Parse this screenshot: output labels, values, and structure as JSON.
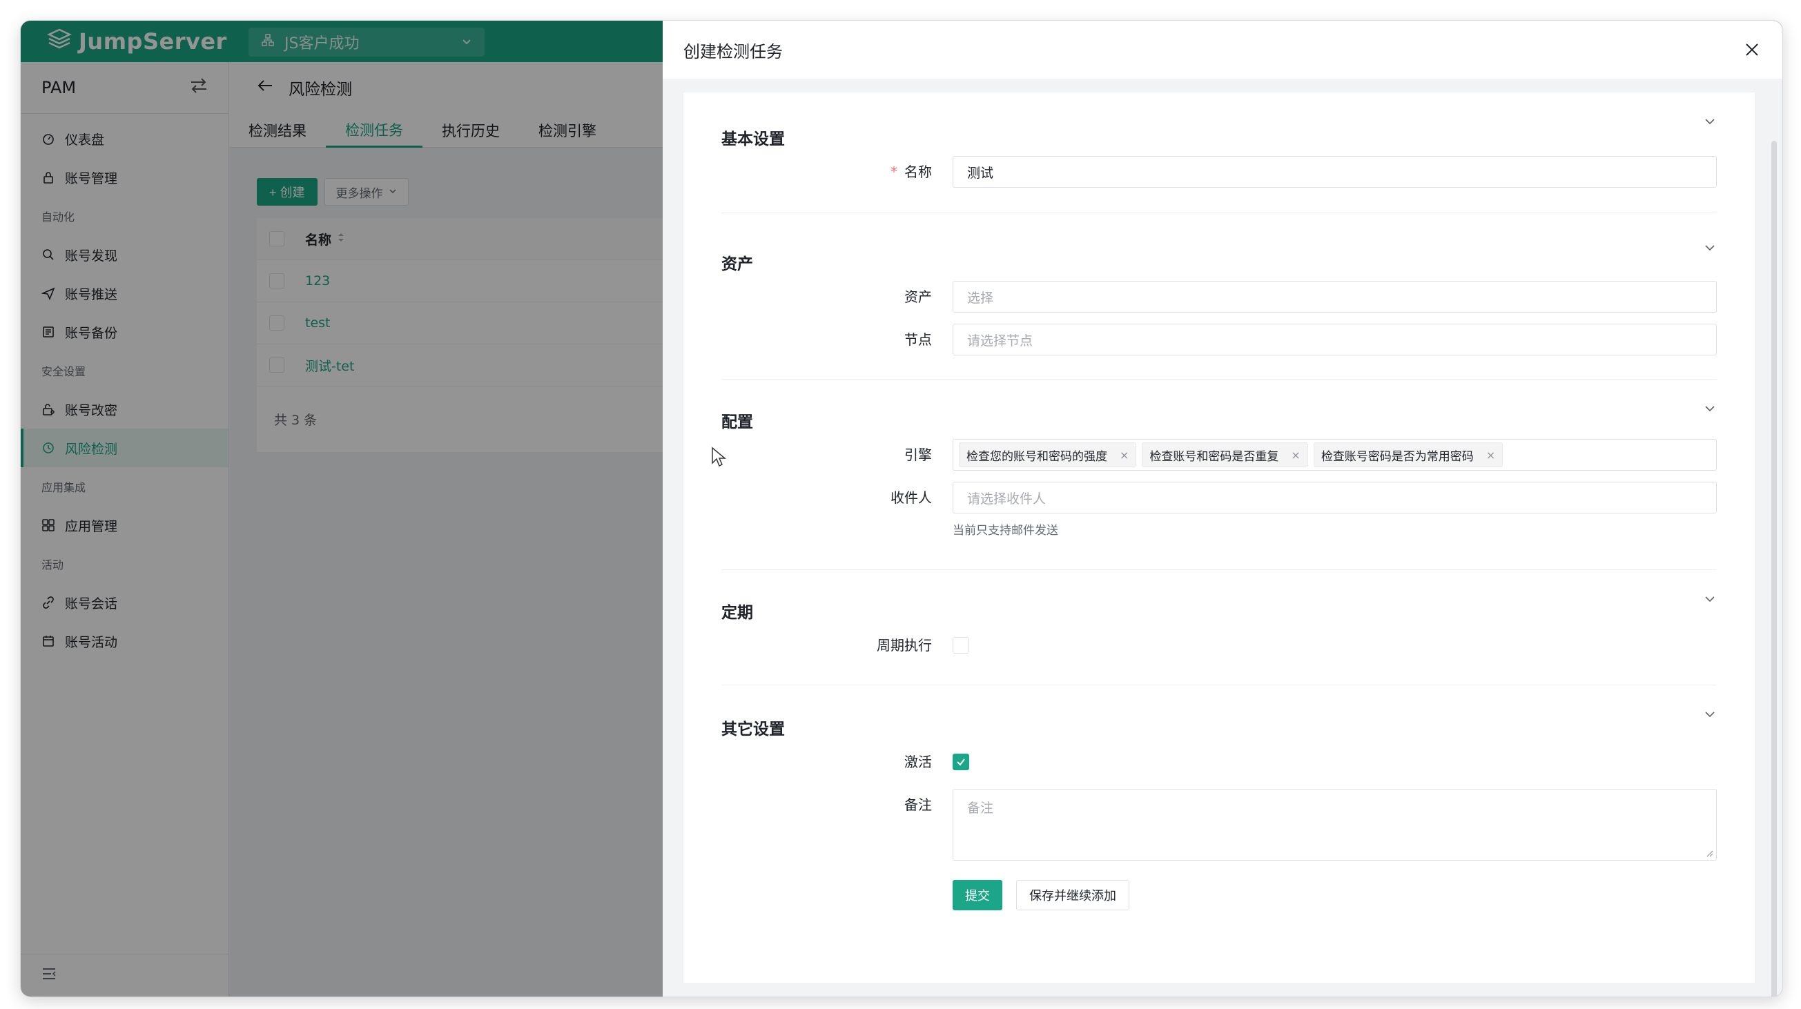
{
  "app": {
    "logo_text": "JumpServer",
    "org_name": "JS客户成功"
  },
  "sidebar": {
    "title": "PAM",
    "items": [
      {
        "label": "仪表盘",
        "icon": "dashboard-icon"
      },
      {
        "label": "账号管理",
        "icon": "lock-icon"
      }
    ],
    "group_automation": "自动化",
    "automation_items": [
      {
        "label": "账号发现",
        "icon": "search-icon"
      },
      {
        "label": "账号推送",
        "icon": "send-icon"
      },
      {
        "label": "账号备份",
        "icon": "backup-icon"
      }
    ],
    "group_security": "安全设置",
    "security_items": [
      {
        "label": "账号改密",
        "icon": "key-lock-icon"
      },
      {
        "label": "风险检测",
        "icon": "risk-icon",
        "active": true
      }
    ],
    "group_integration": "应用集成",
    "integration_items": [
      {
        "label": "应用管理",
        "icon": "apps-icon"
      }
    ],
    "group_activity": "活动",
    "activity_items": [
      {
        "label": "账号会话",
        "icon": "link-icon"
      },
      {
        "label": "账号活动",
        "icon": "calendar-icon"
      }
    ]
  },
  "page": {
    "title": "风险检测",
    "tabs": [
      "检测结果",
      "检测任务",
      "执行历史",
      "检测引擎"
    ],
    "active_tab": 1,
    "create_label": "+ 创建",
    "more_label": "更多操作",
    "table": {
      "header_name": "名称",
      "rows": [
        "123",
        "test",
        "测试-tet"
      ]
    },
    "total_text": "共 3 条"
  },
  "drawer": {
    "title": "创建检测任务",
    "sections": {
      "basic": "基本设置",
      "assets": "资产",
      "config": "配置",
      "periodic": "定期",
      "other": "其它设置"
    },
    "fields": {
      "name_label": "名称",
      "name_value": "测试",
      "asset_label": "资产",
      "asset_placeholder": "选择",
      "node_label": "节点",
      "node_placeholder": "请选择节点",
      "engine_label": "引擎",
      "engine_tags": [
        "检查您的账号和密码的强度",
        "检查账号和密码是否重复",
        "检查账号密码是否为常用密码"
      ],
      "recipient_label": "收件人",
      "recipient_placeholder": "请选择收件人",
      "recipient_hint": "当前只支持邮件发送",
      "periodic_label": "周期执行",
      "periodic_checked": false,
      "active_label": "激活",
      "active_checked": true,
      "comment_label": "备注",
      "comment_placeholder": "备注"
    },
    "submit_label": "提交",
    "save_continue_label": "保存并继续添加"
  },
  "colors": {
    "brand": "#1ba787",
    "required": "#f56c6c"
  }
}
